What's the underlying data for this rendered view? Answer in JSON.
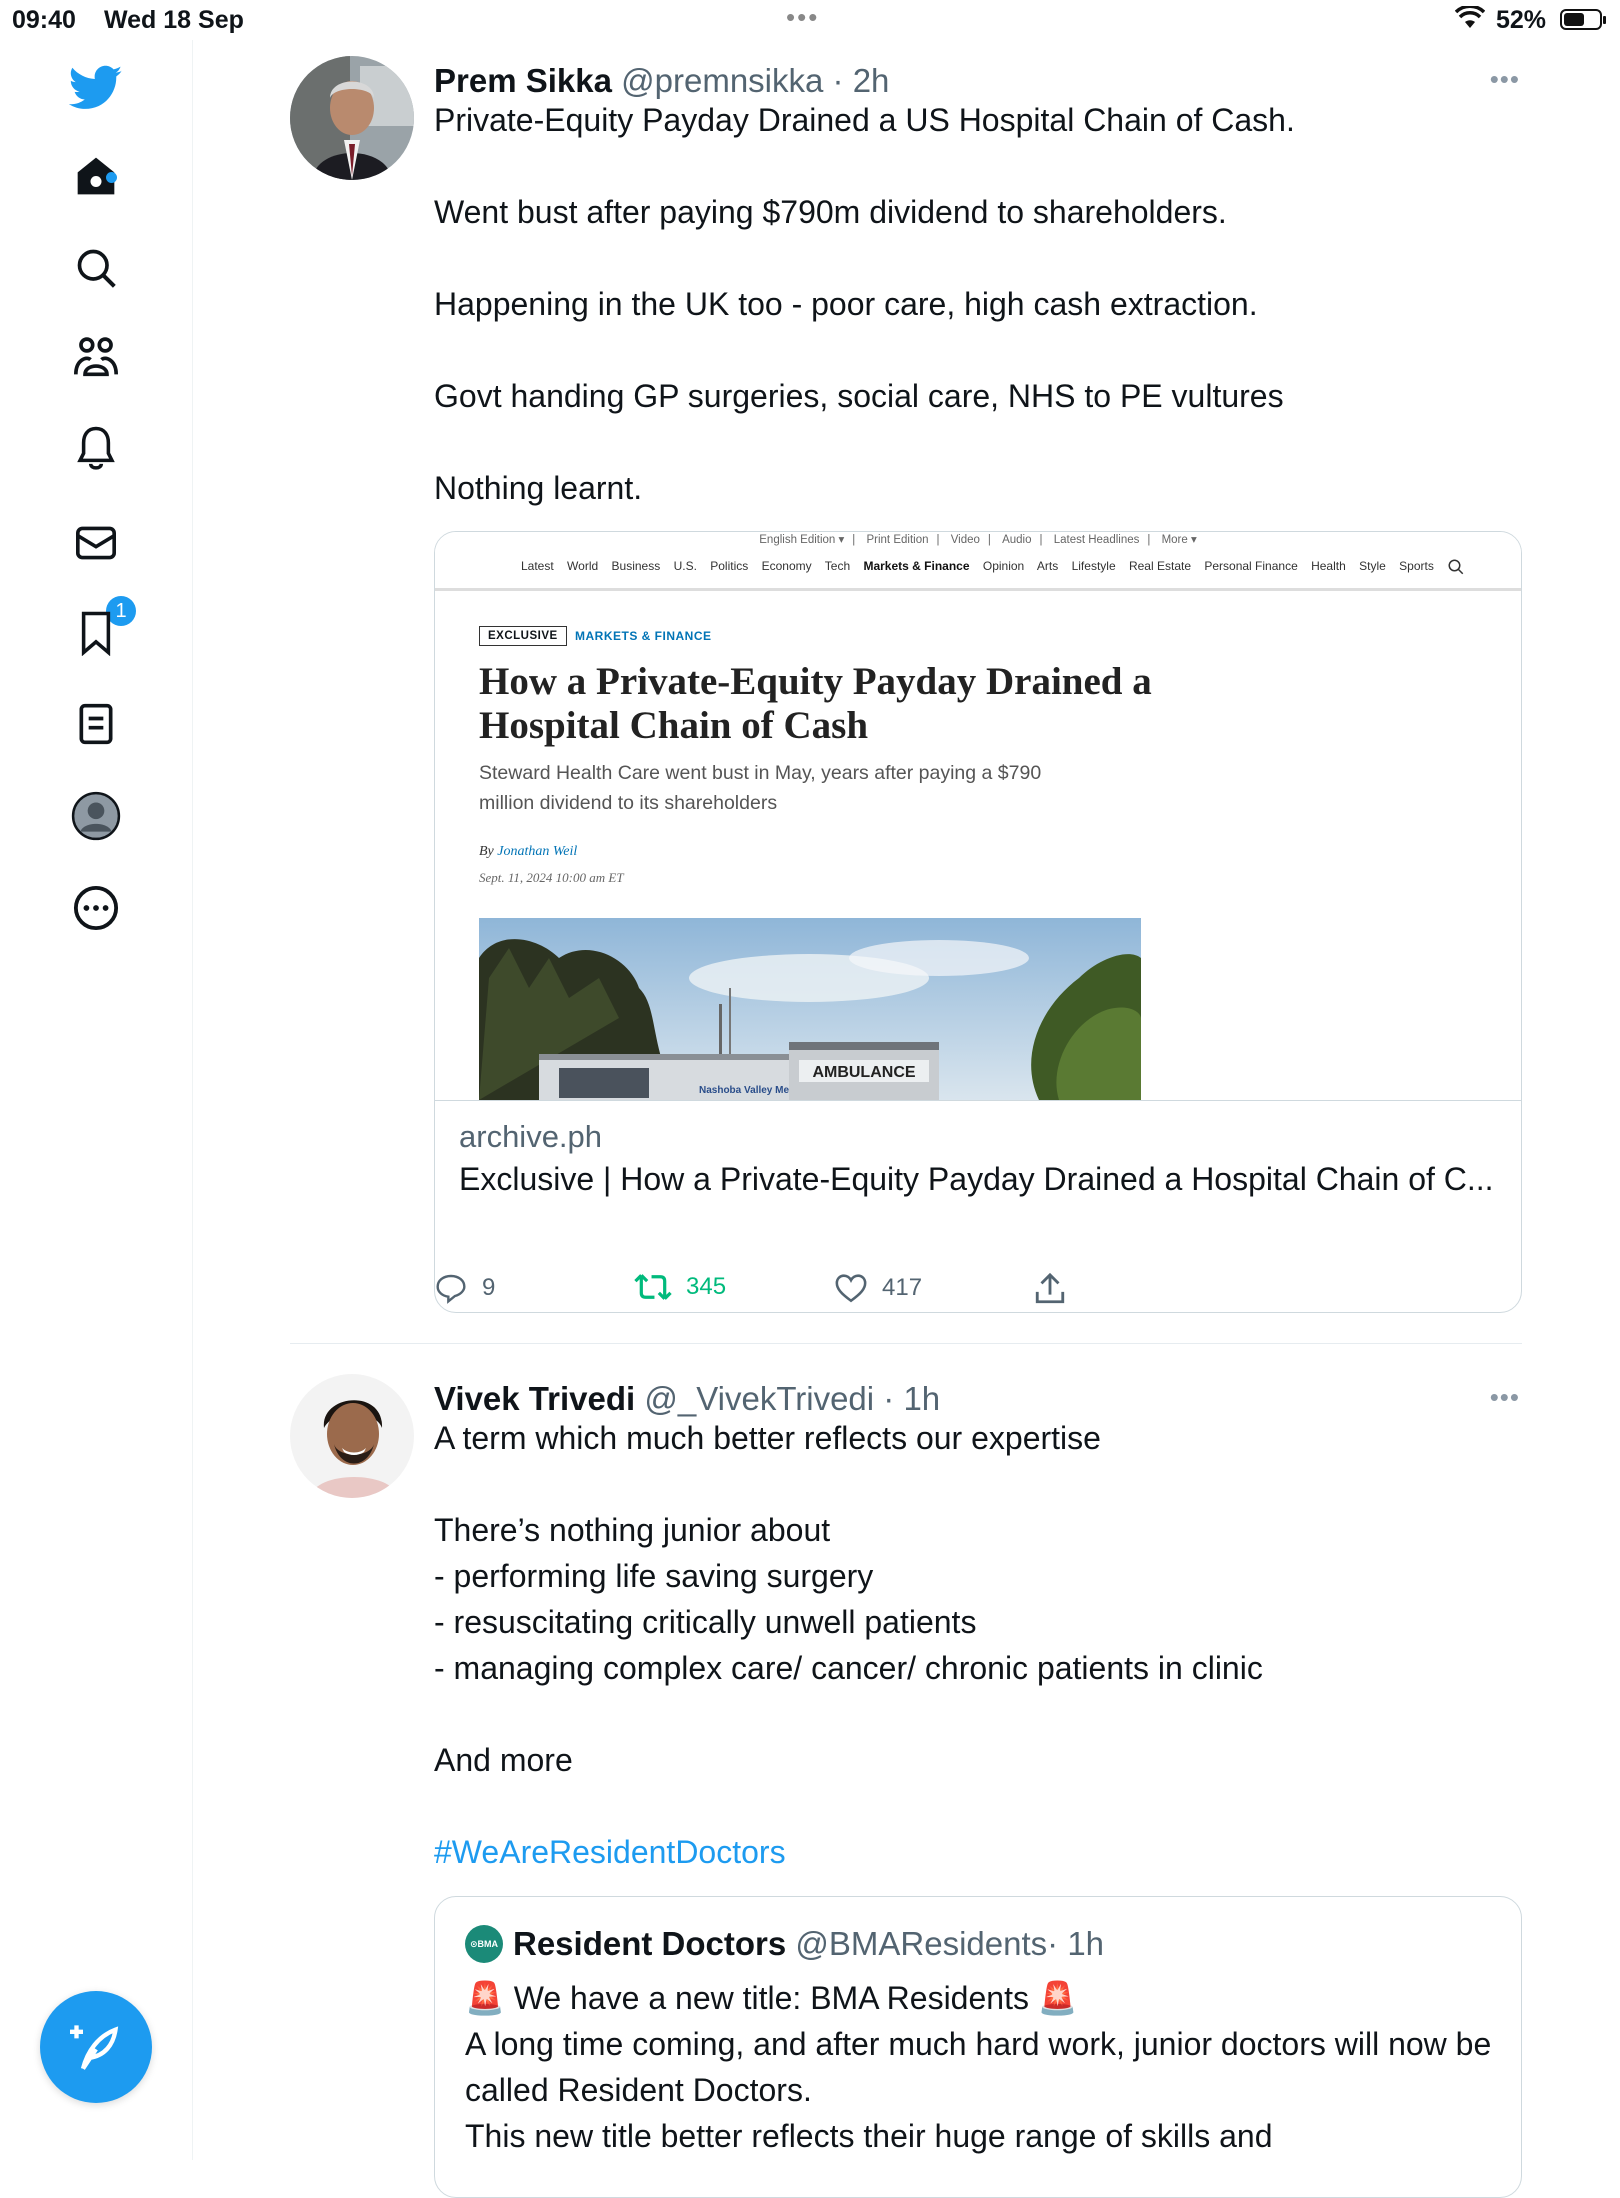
{
  "status_bar": {
    "time": "09:40",
    "date": "Wed 18 Sep",
    "battery": "52%"
  },
  "sidebar": {
    "items": [
      {
        "icon": "twitter-bird-icon"
      },
      {
        "icon": "home-icon",
        "has_dot": true
      },
      {
        "icon": "search-icon"
      },
      {
        "icon": "communities-icon"
      },
      {
        "icon": "notifications-icon",
        "badge": "1"
      },
      {
        "icon": "messages-icon"
      },
      {
        "icon": "bookmarks-icon"
      },
      {
        "icon": "lists-icon"
      },
      {
        "icon": "profile-icon"
      },
      {
        "icon": "more-icon"
      }
    ],
    "notification_badge": "1"
  },
  "colors": {
    "accent": "#1d9bf0",
    "retweet_green": "#00ba7c",
    "bma_green": "#1b8a78"
  },
  "tweet1": {
    "name": "Prem Sikka",
    "handle": "@premnsikka",
    "time": " · 2h",
    "text": "Private-Equity Payday Drained a US Hospital Chain of Cash.\n\nWent bust after paying $790m dividend to shareholders.\n\nHappening in the UK too - poor care, high cash extraction.\n\nGovt handing GP surgeries, social care, NHS to PE vultures\n\nNothing learnt.",
    "card": {
      "nav_top": [
        "English Edition ▾",
        "Print Edition",
        "Video",
        "Audio",
        "Latest Headlines",
        "More ▾"
      ],
      "nav_sections": [
        "Latest",
        "World",
        "Business",
        "U.S.",
        "Politics",
        "Economy",
        "Tech",
        "Markets & Finance",
        "Opinion",
        "Arts",
        "Lifestyle",
        "Real Estate",
        "Personal Finance",
        "Health",
        "Style",
        "Sports"
      ],
      "tag": "EXCLUSIVE",
      "section": "MARKETS & FINANCE",
      "headline": "How a Private-Equity Payday Drained a Hospital Chain of Cash",
      "dek": "Steward Health Care went bust in May, years after paying a $790 million dividend to its shareholders",
      "by": "By ",
      "author": "Jonathan Weil",
      "date": "Sept. 11, 2024 10:00 am ET",
      "photo_sign_1": "AMBULANCE",
      "photo_sign_2": "Nashoba Valley Me",
      "domain": "archive.ph",
      "title": "Exclusive | How a Private-Equity Payday Drained a Hospital Chain of C..."
    },
    "actions": {
      "replies": "9",
      "retweets": "345",
      "likes": "417"
    }
  },
  "tweet2": {
    "name": "Vivek Trivedi",
    "handle": "@_VivekTrivedi",
    "time": " · 1h",
    "text_plain": "A term which much better reflects our expertise\n\nThere’s nothing junior about\n- performing life saving surgery\n- resuscitating critically unwell patients\n- managing complex care/ cancer/ chronic patients in clinic\n\nAnd more\n\n",
    "hashtag": "#WeAreResidentDoctors",
    "quote": {
      "logo_text": "⊙BMA",
      "name": "Resident Doctors",
      "handle": "@BMAResidents",
      "time": " · 1h",
      "text": "🚨 We have a new title: BMA Residents 🚨\nA long time coming, and after much hard work, junior doctors will now be called Resident Doctors.\nThis new title better reflects their huge range of skills and"
    }
  }
}
